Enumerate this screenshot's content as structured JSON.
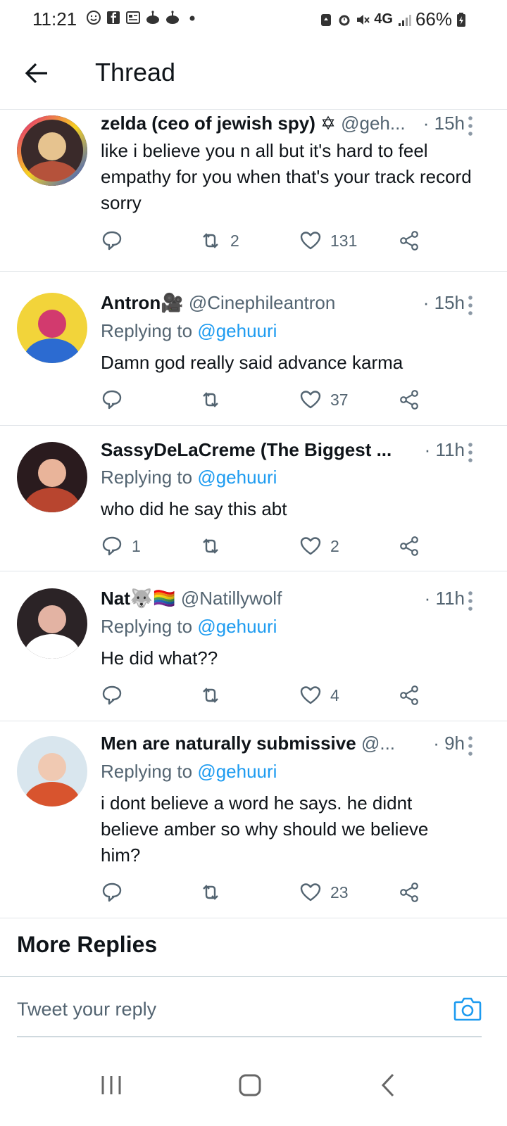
{
  "status_bar": {
    "time": "11:21",
    "battery": "66%",
    "network": "4G",
    "left_icons": [
      "smiley-icon",
      "facebook-icon",
      "news-icon",
      "cake-icon",
      "cake-icon",
      "dot-icon"
    ],
    "right_icons": [
      "battery-saver-icon",
      "alarm-icon",
      "mute-icon",
      "network-4g-icon",
      "signal-icon",
      "battery-icon"
    ]
  },
  "header": {
    "title": "Thread",
    "back_icon": "arrow-left-icon"
  },
  "tweets": [
    {
      "name": "zelda (ceo of jewish spy) ✡",
      "handle": "@geh...",
      "time": "· 15h",
      "replying_prefix": "",
      "replying_to": "",
      "text": "like i believe you n all but it's hard to feel empathy for you when that's your track record sorry",
      "replies": "",
      "retweets": "2",
      "likes": "131",
      "avatar_colors": [
        "#3a2a2a",
        "#b5523b",
        "#e6c38f"
      ],
      "ring": true
    },
    {
      "name": "Antron🎥",
      "handle": "@Cinephileantron",
      "time": "· 15h",
      "replying_prefix": "Replying to ",
      "replying_to": "@gehuuri",
      "text": "Damn god really said advance karma",
      "replies": "",
      "retweets": "",
      "likes": "37",
      "avatar_colors": [
        "#f2d43a",
        "#2c6bd1",
        "#d23a6e"
      ],
      "ring": false
    },
    {
      "name": "SassyDeLaCreme (The Biggest ...",
      "handle": "",
      "time": "· 11h",
      "replying_prefix": "Replying to ",
      "replying_to": "@gehuuri",
      "text": "who did he say this abt",
      "replies": "1",
      "retweets": "",
      "likes": "2",
      "avatar_colors": [
        "#2a1b1e",
        "#b8452f",
        "#e9b49a"
      ],
      "ring": false
    },
    {
      "name": "Nat🐺🏳️‍🌈",
      "handle": "@Natillywolf",
      "time": "· 11h",
      "replying_prefix": "Replying to ",
      "replying_to": "@gehuuri",
      "text": "He did what??",
      "replies": "",
      "retweets": "",
      "likes": "4",
      "avatar_colors": [
        "#2b2326",
        "#ffffff",
        "#e3b3a3"
      ],
      "ring": false
    },
    {
      "name": "Men are naturally submissive",
      "handle": "@...",
      "time": "· 9h",
      "replying_prefix": "Replying to ",
      "replying_to": "@gehuuri",
      "text": "i dont believe a word he says. he didnt believe amber so why should we believe him?",
      "replies": "",
      "retweets": "",
      "likes": "23",
      "avatar_colors": [
        "#d9e6ee",
        "#d8542e",
        "#f0c9b2"
      ],
      "ring": false
    }
  ],
  "more_replies": {
    "title": "More Replies"
  },
  "composer": {
    "placeholder": "Tweet your reply",
    "camera_icon": "camera-icon"
  },
  "nav_bar": {
    "buttons": [
      "recents-icon",
      "home-icon",
      "back-icon"
    ]
  },
  "colors": {
    "accent": "#1d9bf0",
    "text_primary": "#0f1419",
    "text_secondary": "#536471",
    "divider": "#e1e5e9"
  }
}
